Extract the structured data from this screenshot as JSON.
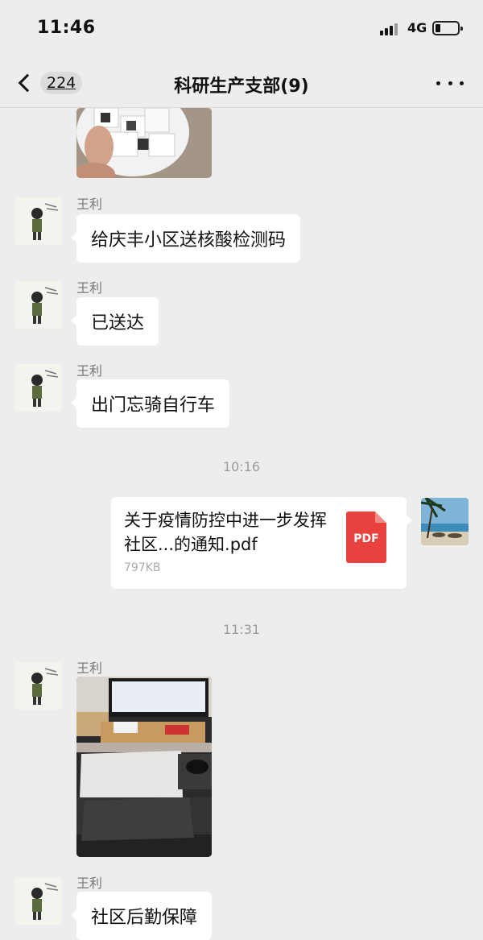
{
  "status_bar": {
    "time": "11:46",
    "network": "4G"
  },
  "nav": {
    "back_count": "224",
    "title": "科研生产支部(9)"
  },
  "messages": {
    "m1": {
      "sender": "王利",
      "text": "给庆丰小区送核酸检测码"
    },
    "m2": {
      "sender": "王利",
      "text": "已送达"
    },
    "m3": {
      "sender": "王利",
      "text": "出门忘骑自行车"
    },
    "ts1": "10:16",
    "file": {
      "name": "关于疫情防控中进一步发挥社区...的通知.pdf",
      "size": "797KB",
      "icon_label": "PDF"
    },
    "ts2": "11:31",
    "m4": {
      "sender": "王利"
    },
    "m5": {
      "sender": "王利",
      "text": "社区后勤保障"
    }
  },
  "colors": {
    "background": "#ededed",
    "bubble": "#ffffff",
    "pdf_icon": "#e9413e"
  }
}
